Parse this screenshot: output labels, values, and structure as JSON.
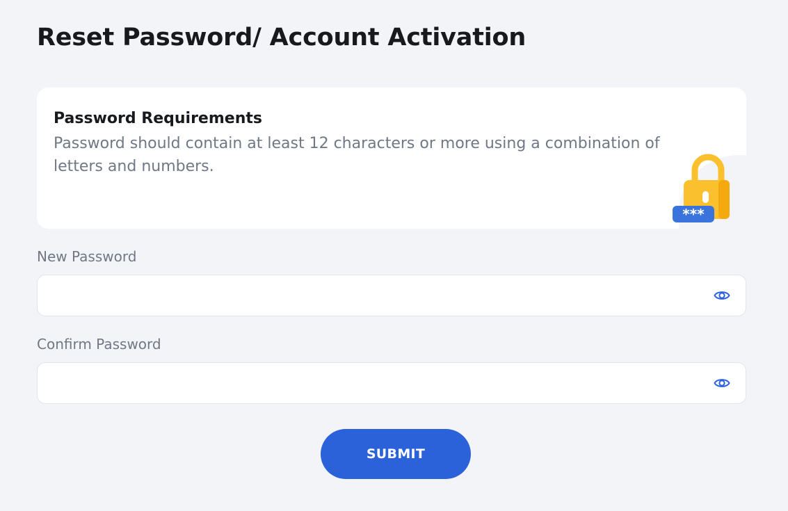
{
  "page": {
    "title": "Reset Password/ Account Activation"
  },
  "requirements": {
    "title": "Password Requirements",
    "text": "Password should contain at least 12 characters or more using a combination of letters and numbers.",
    "illustration": "lock-with-asterisks-icon",
    "mask_text": "***"
  },
  "form": {
    "new_password": {
      "label": "New Password",
      "value": "",
      "placeholder": "",
      "toggle_icon": "eye-icon"
    },
    "confirm_password": {
      "label": "Confirm Password",
      "value": "",
      "placeholder": "",
      "toggle_icon": "eye-icon"
    },
    "submit_label": "SUBMIT"
  },
  "colors": {
    "background": "#f3f4f7",
    "card": "#ffffff",
    "accent": "#2b62d9",
    "lock_body": "#fbc02d",
    "title_text": "#17191c",
    "muted_text": "#6f7884"
  }
}
